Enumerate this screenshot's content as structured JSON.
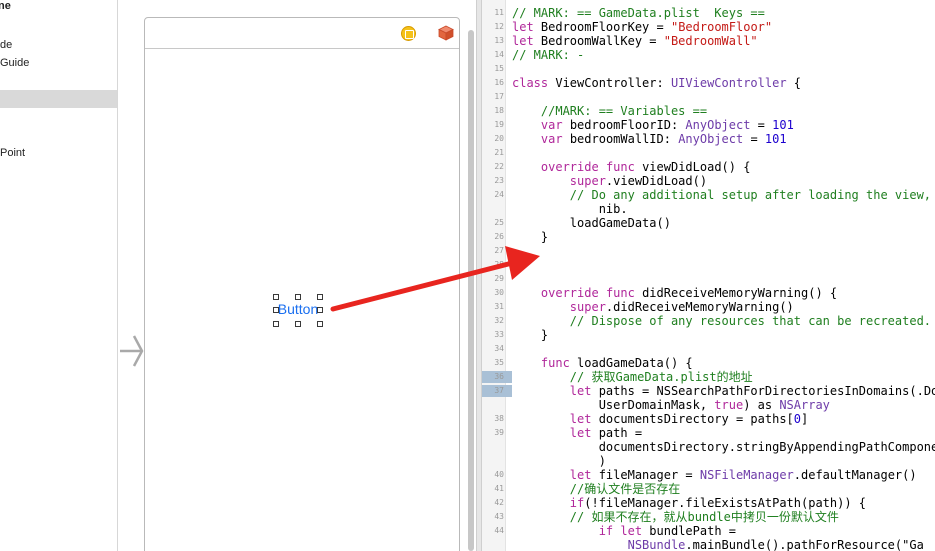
{
  "outline": {
    "items": [
      {
        "label": "ne",
        "bold": true
      },
      {
        "label": "de",
        "bold": false
      },
      {
        "label": "Guide",
        "bold": false
      },
      {
        "label": "Point",
        "bold": false
      }
    ]
  },
  "canvas": {
    "button_label": "Button"
  },
  "editor": {
    "lines": [
      {
        "n": "11",
        "text": "// MARK: == GameData.plist  Keys =="
      },
      {
        "n": "12",
        "text": "let BedroomFloorKey = \"BedroomFloor\""
      },
      {
        "n": "13",
        "text": "let BedroomWallKey = \"BedroomWall\""
      },
      {
        "n": "14",
        "text": "// MARK: -"
      },
      {
        "n": "15",
        "text": ""
      },
      {
        "n": "16",
        "text": "class ViewController: UIViewController {"
      },
      {
        "n": "17",
        "text": ""
      },
      {
        "n": "18",
        "text": "    //MARK: == Variables =="
      },
      {
        "n": "19",
        "text": "    var bedroomFloorID: AnyObject = 101"
      },
      {
        "n": "20",
        "text": "    var bedroomWallID: AnyObject = 101"
      },
      {
        "n": "21",
        "text": ""
      },
      {
        "n": "22",
        "text": "    override func viewDidLoad() {"
      },
      {
        "n": "23",
        "text": "        super.viewDidLoad()"
      },
      {
        "n": "24",
        "text": "        // Do any additional setup after loading the view,"
      },
      {
        "n": "",
        "text": "            nib."
      },
      {
        "n": "25",
        "text": "        loadGameData()"
      },
      {
        "n": "26",
        "text": "    }"
      },
      {
        "n": "27",
        "text": ""
      },
      {
        "n": "28",
        "text": ""
      },
      {
        "n": "29",
        "text": ""
      },
      {
        "n": "30",
        "text": "    override func didReceiveMemoryWarning() {"
      },
      {
        "n": "31",
        "text": "        super.didReceiveMemoryWarning()"
      },
      {
        "n": "32",
        "text": "        // Dispose of any resources that can be recreated."
      },
      {
        "n": "33",
        "text": "    }"
      },
      {
        "n": "34",
        "text": ""
      },
      {
        "n": "35",
        "text": "    func loadGameData() {"
      },
      {
        "n": "36",
        "text": "        // 获取GameData.plist的地址"
      },
      {
        "n": "37",
        "text": "        let paths = NSSearchPathForDirectoriesInDomains(.Do"
      },
      {
        "n": "",
        "text": "            UserDomainMask, true) as NSArray"
      },
      {
        "n": "38",
        "text": "        let documentsDirectory = paths[0]"
      },
      {
        "n": "39",
        "text": "        let path ="
      },
      {
        "n": "",
        "text": "            documentsDirectory.stringByAppendingPathCompone"
      },
      {
        "n": "",
        "text": "            )"
      },
      {
        "n": "40",
        "text": "        let fileManager = NSFileManager.defaultManager()"
      },
      {
        "n": "41",
        "text": "        //确认文件是否存在"
      },
      {
        "n": "42",
        "text": "        if(!fileManager.fileExistsAtPath(path)) {"
      },
      {
        "n": "43",
        "text": "        // 如果不存在，就从bundle中拷贝一份默认文件"
      },
      {
        "n": "44",
        "text": "            if let bundlePath ="
      },
      {
        "n": "",
        "text": "                NSBundle.mainBundle().pathForResource(\"Ga"
      }
    ],
    "breakpoint_lines": [
      "36",
      "37"
    ]
  },
  "colors": {
    "annotation_arrow": "#e8251f",
    "button_text": "#1a6ff0",
    "comment": "#1f7f1f",
    "keyword": "#b0279a",
    "string": "#c41a16",
    "number": "#1c00cf",
    "type": "#6d3ba8",
    "breakpoint": "#a9c0d6"
  },
  "icons": [
    "view-controller-icon",
    "first-responder-cube-icon",
    "entry-point-arrow-icon",
    "annotation-arrow"
  ]
}
